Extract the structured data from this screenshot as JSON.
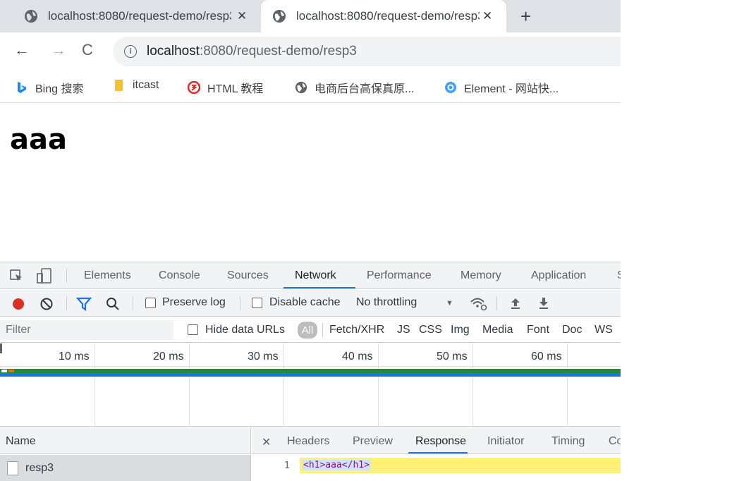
{
  "browser": {
    "tabs": [
      {
        "title": "localhost:8080/request-demo/resp3",
        "close": "✕"
      },
      {
        "title": "localhost:8080/request-demo/resp3",
        "close": "✕"
      }
    ],
    "new_tab": "+",
    "nav": {
      "back": "←",
      "forward": "→",
      "reload": "C"
    },
    "url": {
      "host": "localhost",
      "rest": ":8080/request-demo/resp3"
    },
    "bookmarks": [
      {
        "label": "Bing 搜索",
        "icon": "bing-icon"
      },
      {
        "label": "itcast",
        "icon": "folder-icon"
      },
      {
        "label": "HTML 教程",
        "icon": "runoob-icon"
      },
      {
        "label": "电商后台高保真原...",
        "icon": "globe-icon"
      },
      {
        "label": "Element - 网站快...",
        "icon": "element-icon"
      }
    ]
  },
  "page": {
    "heading": "aaa"
  },
  "devtools": {
    "tabs": [
      "Elements",
      "Console",
      "Sources",
      "Network",
      "Performance",
      "Memory",
      "Application",
      "S"
    ],
    "active_tab": "Network",
    "toolbar": {
      "preserve_log": "Preserve log",
      "disable_cache": "Disable cache",
      "throttling": "No throttling",
      "throttling_arrow": "▼"
    },
    "filter": {
      "placeholder": "Filter",
      "hide_data_urls": "Hide data URLs",
      "types": [
        "All",
        "Fetch/XHR",
        "JS",
        "CSS",
        "Img",
        "Media",
        "Font",
        "Doc",
        "WS"
      ]
    },
    "timeline": {
      "ticks": [
        "10 ms",
        "20 ms",
        "30 ms",
        "40 ms",
        "50 ms",
        "60 ms"
      ]
    },
    "requests": {
      "name_header": "Name",
      "rows": [
        {
          "name": "resp3"
        }
      ]
    },
    "detail": {
      "close": "✕",
      "tabs": [
        "Headers",
        "Preview",
        "Response",
        "Initiator",
        "Timing",
        "Co"
      ],
      "active_tab": "Response",
      "response": {
        "line_number": "1",
        "code": "<h1>aaa</h1>"
      }
    }
  }
}
